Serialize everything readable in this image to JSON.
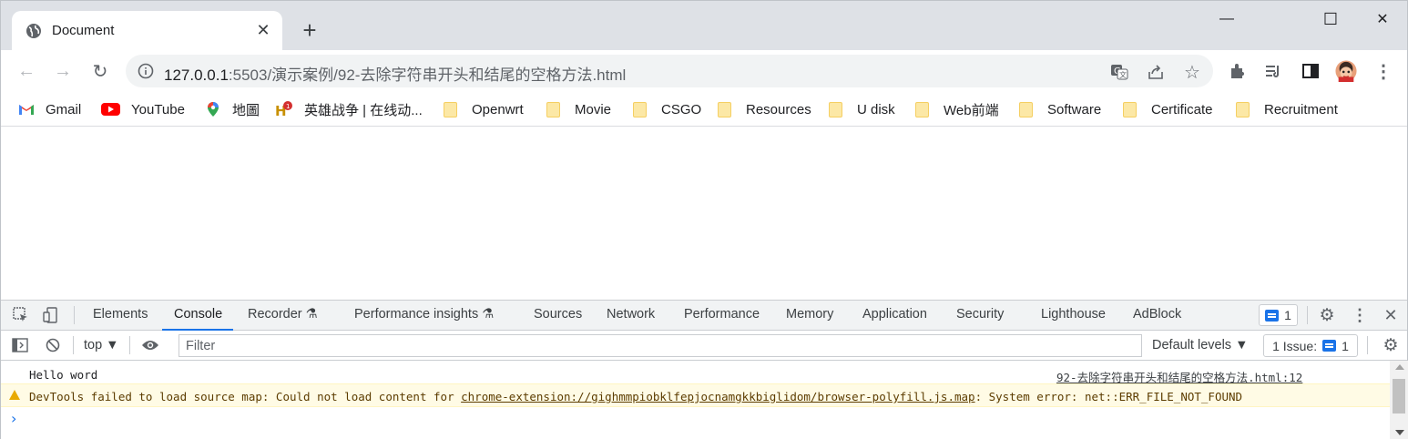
{
  "tab": {
    "title": "Document",
    "close": "✕",
    "new_tab": "+"
  },
  "window_controls": {
    "minimize": "—",
    "maximize": "☐",
    "close": "✕"
  },
  "address": {
    "host": "127.0.0.1",
    "path": ":5503/演示案例/92-去除字符串开头和结尾的空格方法.html"
  },
  "bookmarks": [
    {
      "label": "Gmail",
      "icon": "gmail-icon"
    },
    {
      "label": "YouTube",
      "icon": "youtube-icon"
    },
    {
      "label": "地圖",
      "icon": "maps-pin-icon"
    },
    {
      "label": "英雄战争 | 在线动...",
      "icon": "game-icon"
    },
    {
      "label": "Openwrt",
      "icon": "folder-icon"
    },
    {
      "label": "Movie",
      "icon": "folder-icon"
    },
    {
      "label": "CSGO",
      "icon": "folder-icon"
    },
    {
      "label": "Resources",
      "icon": "folder-icon"
    },
    {
      "label": "U disk",
      "icon": "folder-icon"
    },
    {
      "label": "Web前端",
      "icon": "folder-icon"
    },
    {
      "label": "Software",
      "icon": "folder-icon"
    },
    {
      "label": "Certificate",
      "icon": "folder-icon"
    },
    {
      "label": "Recruitment",
      "icon": "folder-icon"
    }
  ],
  "devtools": {
    "tabs": [
      "Elements",
      "Console",
      "Recorder ⚗",
      "Performance insights ⚗",
      "Sources",
      "Network",
      "Performance",
      "Memory",
      "Application",
      "Security",
      "Lighthouse",
      "AdBlock"
    ],
    "active_tab": "Console",
    "issues_count": "1",
    "context": "top ▼",
    "filter_placeholder": "Filter",
    "levels": "Default levels ▼",
    "issues_label": "1 Issue:",
    "issues_label_count": "1"
  },
  "console": {
    "log_text": "Hello word",
    "log_source": "92-去除字符串开头和结尾的空格方法.html:12",
    "warn_prefix": "DevTools failed to load source map: Could not load content for ",
    "warn_link": "chrome-extension://gighmmpiobklfepjocnamgkkbiglidom/browser-polyfill.js.map",
    "warn_suffix": ": System error: net::ERR_FILE_NOT_FOUND",
    "prompt": "›"
  },
  "colors": {
    "accent": "#1a73e8",
    "warning_bg": "#fffbe5",
    "folder": "#fce8a6"
  }
}
